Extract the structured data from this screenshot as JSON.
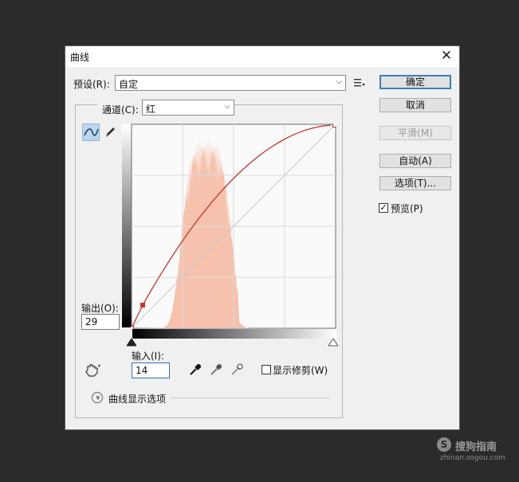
{
  "dialog": {
    "title": "曲线",
    "close_glyph": "✕",
    "preset_label": "预设(R):",
    "preset_value": "自定",
    "channel_label": "通道(C):",
    "channel_value": "红",
    "output_label": "输出(O):",
    "output_value": "29",
    "input_label": "输入(I):",
    "input_value": "14",
    "show_clipping_label": "显示修剪(W)",
    "show_clipping_checked": false,
    "curve_display_options_label": "曲线显示选项",
    "buttons": {
      "ok": "确定",
      "cancel": "取消",
      "smooth": "平滑(M)",
      "auto": "自动(A)",
      "options": "选项(T)..."
    },
    "preview_label": "预览(P)",
    "preview_checked": true,
    "check_glyph": "✓",
    "chevron_glyph": "⌵",
    "expand_glyph": "»"
  },
  "watermark": {
    "brand": "搜狗指南",
    "url": "zhinan.sogou.com",
    "logo_glyph": "S"
  },
  "colors": {
    "curve": "#c0382b",
    "histogram": "#f6c1ad",
    "accent": "#3c7fb1"
  },
  "curve_points": [
    [
      0,
      0
    ],
    [
      14,
      29
    ],
    [
      255,
      255
    ]
  ]
}
